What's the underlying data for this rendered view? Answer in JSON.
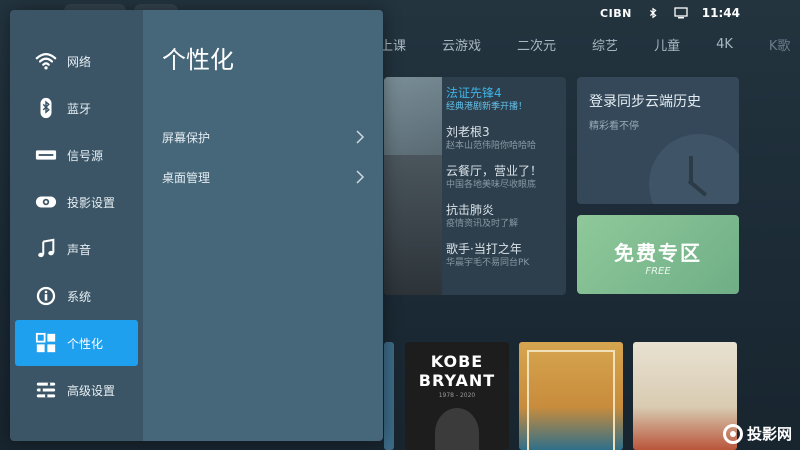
{
  "status_bar": {
    "brand": "CIBN",
    "time": "11:44",
    "icons": [
      "bluetooth-icon",
      "monitor-icon"
    ]
  },
  "nav": {
    "items": [
      "上课",
      "云游戏",
      "二次元",
      "综艺",
      "儿童",
      "4K",
      "K歌"
    ]
  },
  "feature": {
    "entries": [
      {
        "title": "法证先锋4",
        "subtitle": "经典港剧新季开播！"
      },
      {
        "title": "刘老根3",
        "subtitle": "赵本山范伟陪你哈哈哈"
      },
      {
        "title": "云餐厅，营业了！",
        "subtitle": "中国各地美味尽收眼底"
      },
      {
        "title": "抗击肺炎",
        "subtitle": "疫情资讯及时了解"
      },
      {
        "title": "歌手·当打之年",
        "subtitle": "华晨宇毛不易同台PK"
      }
    ]
  },
  "history_card": {
    "title": "登录同步云端历史",
    "subtitle": "精彩看不停"
  },
  "free_card": {
    "title": "免费专区",
    "subtitle": "FREE"
  },
  "posters": {
    "kobe_line1": "KOBE",
    "kobe_line2": "BRYANT",
    "kobe_years": "1978 - 2020"
  },
  "watermark": {
    "name": "投影网"
  },
  "settings": {
    "menu": [
      {
        "label": "网络",
        "icon": "wifi-icon"
      },
      {
        "label": "蓝牙",
        "icon": "bluetooth-icon"
      },
      {
        "label": "信号源",
        "icon": "signal-source-icon"
      },
      {
        "label": "投影设置",
        "icon": "projector-icon"
      },
      {
        "label": "声音",
        "icon": "music-note-icon"
      },
      {
        "label": "系统",
        "icon": "info-icon"
      },
      {
        "label": "个性化",
        "icon": "grid-icon"
      },
      {
        "label": "高级设置",
        "icon": "sliders-icon"
      }
    ],
    "selected_index": 6,
    "detail_title": "个性化",
    "detail_rows": [
      "屏幕保护",
      "桌面管理"
    ],
    "colors": {
      "menu_bg": "#3b5566",
      "detail_bg": "#46667a",
      "selected": "#1ea0ef",
      "accent_text": "#3fb3e6"
    }
  }
}
